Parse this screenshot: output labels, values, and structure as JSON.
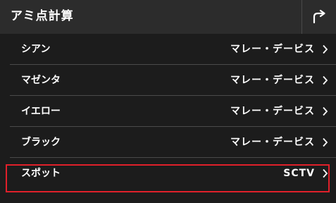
{
  "header": {
    "title": "アミ点計算",
    "share_icon": "share-arrow-icon"
  },
  "rows": [
    {
      "label": "シアン",
      "value": "マレー・デービス"
    },
    {
      "label": "マゼンタ",
      "value": "マレー・デービス"
    },
    {
      "label": "イエロー",
      "value": "マレー・デービス"
    },
    {
      "label": "ブラック",
      "value": "マレー・デービス"
    },
    {
      "label": "スポット",
      "value": "SCTV"
    }
  ],
  "colors": {
    "background": "#1c1c1c",
    "titlebar": "#2c2c2c",
    "divider": "#4a4a4a",
    "highlight": "#e0202a",
    "text": "#ffffff"
  }
}
